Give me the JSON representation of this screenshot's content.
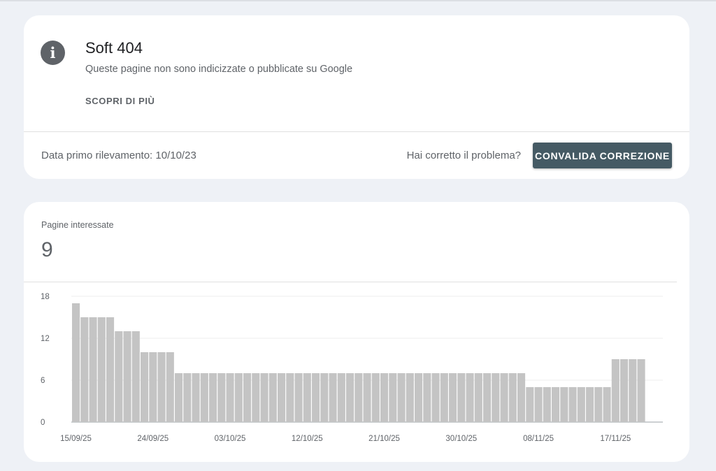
{
  "issue": {
    "icon": "info-icon",
    "title": "Soft 404",
    "subtitle": "Queste pagine non sono indicizzate o pubblicate su Google",
    "learn_more": "SCOPRI DI PIÙ",
    "first_detected": "Data primo rilevamento: 10/10/23",
    "fixed_question": "Hai corretto il problema?",
    "validate_button": "CONVALIDA CORREZIONE"
  },
  "metric": {
    "label": "Pagine interessate",
    "value": "9"
  },
  "colors": {
    "bar": "#c4c4c4",
    "button": "#455a64",
    "background": "#eef1f6"
  },
  "chart_data": {
    "type": "bar",
    "title": "",
    "xlabel": "",
    "ylabel": "",
    "ylim": [
      0,
      18
    ],
    "yticks": [
      0,
      6,
      12,
      18
    ],
    "grid": true,
    "xtick_labels": [
      "15/09/25",
      "24/09/25",
      "03/10/25",
      "12/10/25",
      "21/10/25",
      "30/10/25",
      "08/11/25",
      "17/11/25"
    ],
    "start_date": "15/09/25",
    "values": [
      17,
      15,
      15,
      15,
      15,
      13,
      13,
      13,
      10,
      10,
      10,
      10,
      7,
      7,
      7,
      7,
      7,
      7,
      7,
      7,
      7,
      7,
      7,
      7,
      7,
      7,
      7,
      7,
      7,
      7,
      7,
      7,
      7,
      7,
      7,
      7,
      7,
      7,
      7,
      7,
      7,
      7,
      7,
      7,
      7,
      7,
      7,
      7,
      7,
      7,
      7,
      7,
      7,
      5,
      5,
      5,
      5,
      5,
      5,
      5,
      5,
      5,
      5,
      9,
      9,
      9,
      9
    ]
  }
}
